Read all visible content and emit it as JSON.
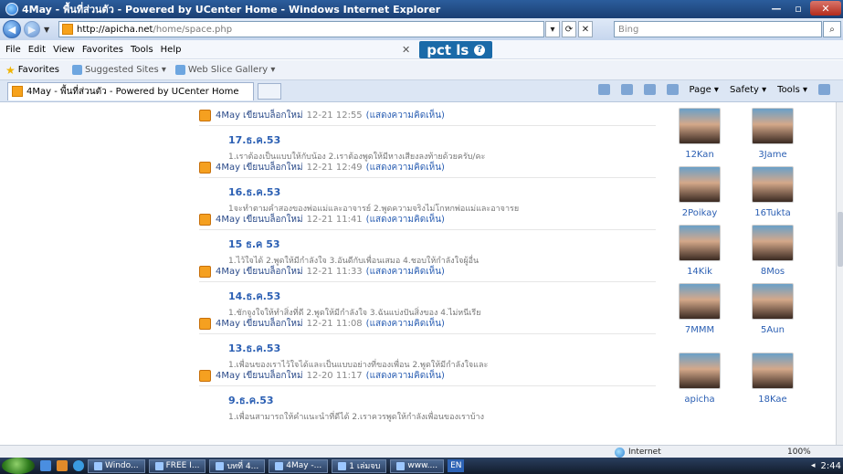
{
  "window": {
    "title": "4May - พื้นที่ส่วนตัว - Powered by UCenter Home - Windows Internet Explorer",
    "controls": {
      "minimize": "—",
      "maximize": "▫",
      "close": "✕"
    }
  },
  "address": {
    "url_domain": "http://apicha.net",
    "url_path": "/home/space.php",
    "search_placeholder": "Bing"
  },
  "menu": [
    "File",
    "Edit",
    "View",
    "Favorites",
    "Tools",
    "Help"
  ],
  "toolbar_brand": {
    "text": "pct  ls",
    "help": "?"
  },
  "favorites": {
    "label": "Favorites",
    "items": [
      "Suggested Sites ▾",
      "Web Slice Gallery ▾"
    ]
  },
  "tab": {
    "title": "4May - พื้นที่ส่วนตัว - Powered by UCenter Home"
  },
  "commands": [
    "Page ▾",
    "Safety ▾",
    "Tools ▾"
  ],
  "feed": [
    {
      "user": "4May",
      "action": "เขียนบล็อกใหม่",
      "time": "12-21 12:55",
      "comment": "(แสดงความคิดเห็น)",
      "post_title": "17.ธ.ค.53",
      "excerpt": "1.เราต้องเป็นแบบให้กับน้อง 2.เราต้องพูดให้มีหางเสียงลงท้ายด้วยครับ/คะ"
    },
    {
      "user": "4May",
      "action": "เขียนบล็อกใหม่",
      "time": "12-21 12:49",
      "comment": "(แสดงความคิดเห็น)",
      "post_title": "16.ธ.ค.53",
      "excerpt": "1จะทำตามคำสองของพ่อแม่และอาจารย์ 2.พูดความจริงไม่โกหกพ่อแม่และอาจารย"
    },
    {
      "user": "4May",
      "action": "เขียนบล็อกใหม่",
      "time": "12-21 11:41",
      "comment": "(แสดงความคิดเห็น)",
      "post_title": "15 ธ.ค 53",
      "excerpt": "1.ไว้ใจได้ 2.พูดให้มีกำลังใจ 3.อันดีกับเพื่อนเสมอ 4.ชอบให้กำลังใจผู้อื่น"
    },
    {
      "user": "4May",
      "action": "เขียนบล็อกใหม่",
      "time": "12-21 11:33",
      "comment": "(แสดงความคิดเห็น)",
      "post_title": "14.ธ.ค.53",
      "excerpt": "1.ชักจูงใจให้ทำสิ่งที่ดี 2.พูดให้มีกำลังใจ 3.ฉันแบ่งปันสิ่งของ 4.ไม่หนีเรีย"
    },
    {
      "user": "4May",
      "action": "เขียนบล็อกใหม่",
      "time": "12-21 11:08",
      "comment": "(แสดงความคิดเห็น)",
      "post_title": "13.ธ.ค.53",
      "excerpt": "1.เพื่อนของเราไว้ใจได้และเป็นแบบอย่างที่ของเพื่อน 2.พูดให้มีกำลังใจและ"
    },
    {
      "user": "4May",
      "action": "เขียนบล็อกใหม่",
      "time": "12-20 11:17",
      "comment": "(แสดงความคิดเห็น)",
      "post_title": "9.ธ.ค.53",
      "excerpt": "1.เพื่อนสามารถให้คำแนะนำที่ดีได้ 2.เราควรพูดให้กำลังเพื่อนของเราบ้าง"
    }
  ],
  "friends": [
    "12Kan",
    "3Jame",
    "2Poikay",
    "16Tukta",
    "14Kik",
    "8Mos",
    "7MMM",
    "5Aun",
    "apicha",
    "18Kae"
  ],
  "statusbar": {
    "zone": "Internet",
    "zoom": "100%"
  },
  "taskbar": {
    "tasks": [
      "Windo...",
      "FREE I...",
      "บทที่ 4...",
      "4May -...",
      "1 เล่มจบ",
      "www...."
    ],
    "lang": "EN",
    "clock": "2:44"
  }
}
